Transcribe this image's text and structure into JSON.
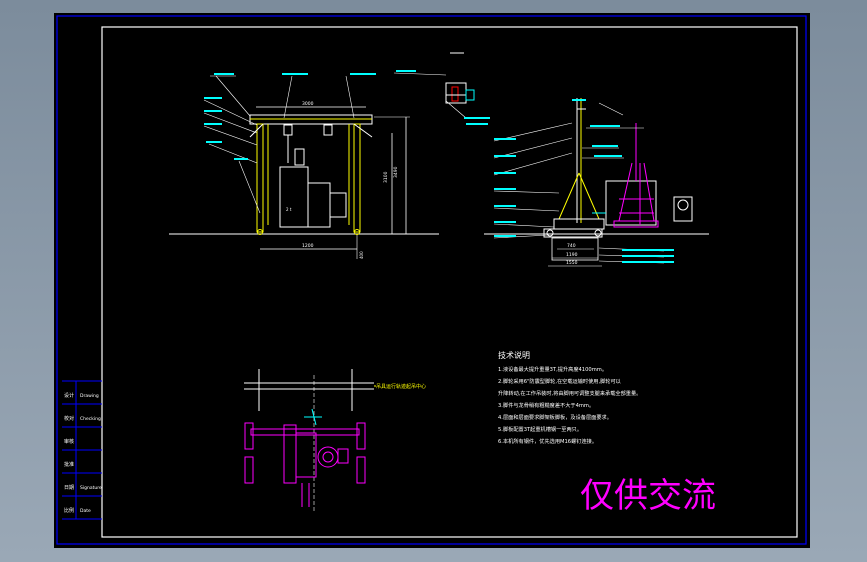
{
  "viewport": {
    "background": "#8a9aaa"
  },
  "sheet": {
    "background": "#000000",
    "frame_color": "#0000ff"
  },
  "colors": {
    "yellow": "#ffff00",
    "cyan": "#00ffff",
    "magenta": "#ff00ff",
    "white": "#ffffff",
    "green": "#00ff00",
    "red": "#ff0000",
    "blue": "#0044ff"
  },
  "title_block": {
    "rows": [
      {
        "label": "设计",
        "value": "Drawing"
      },
      {
        "label": "校对",
        "value": "Checking"
      },
      {
        "label": "审核",
        "value": ""
      },
      {
        "label": "批准",
        "value": ""
      },
      {
        "label": "日期",
        "value": "Signature"
      },
      {
        "label": "比例",
        "value": "Date"
      }
    ]
  },
  "front_view": {
    "dims": {
      "top_span": "3000",
      "height_outer": "3490",
      "height_inner": "3100",
      "base": "1200",
      "side": "400"
    }
  },
  "side_view": {
    "dims": {
      "base_inner": "740",
      "base_mid": "1190",
      "base_outer": "1550"
    }
  },
  "plan_view": {
    "note": "吊具运行轨迹起吊中心"
  },
  "tech_notes": {
    "title": "技术说明",
    "items": [
      "1.液设备最大提升重量3T,提升高度4100mm。",
      "2.脚轮采用6\"防震型脚轮,在空载运输时使用,脚轮可以",
      "  升降转动,在工作吊装时,将由脚用可调整支腿来承载全部重量。",
      "3.脚件与龙骨稍有粗糙度差不大于4mm。",
      "4.层面和层面要求脚架板脚板，及设备层面要求。",
      "5.脚板配置3T起重机槽钢一至两只。",
      "6.本机所有钢件，优先选用M16螺钉连接。"
    ]
  },
  "watermark": "仅供交流"
}
